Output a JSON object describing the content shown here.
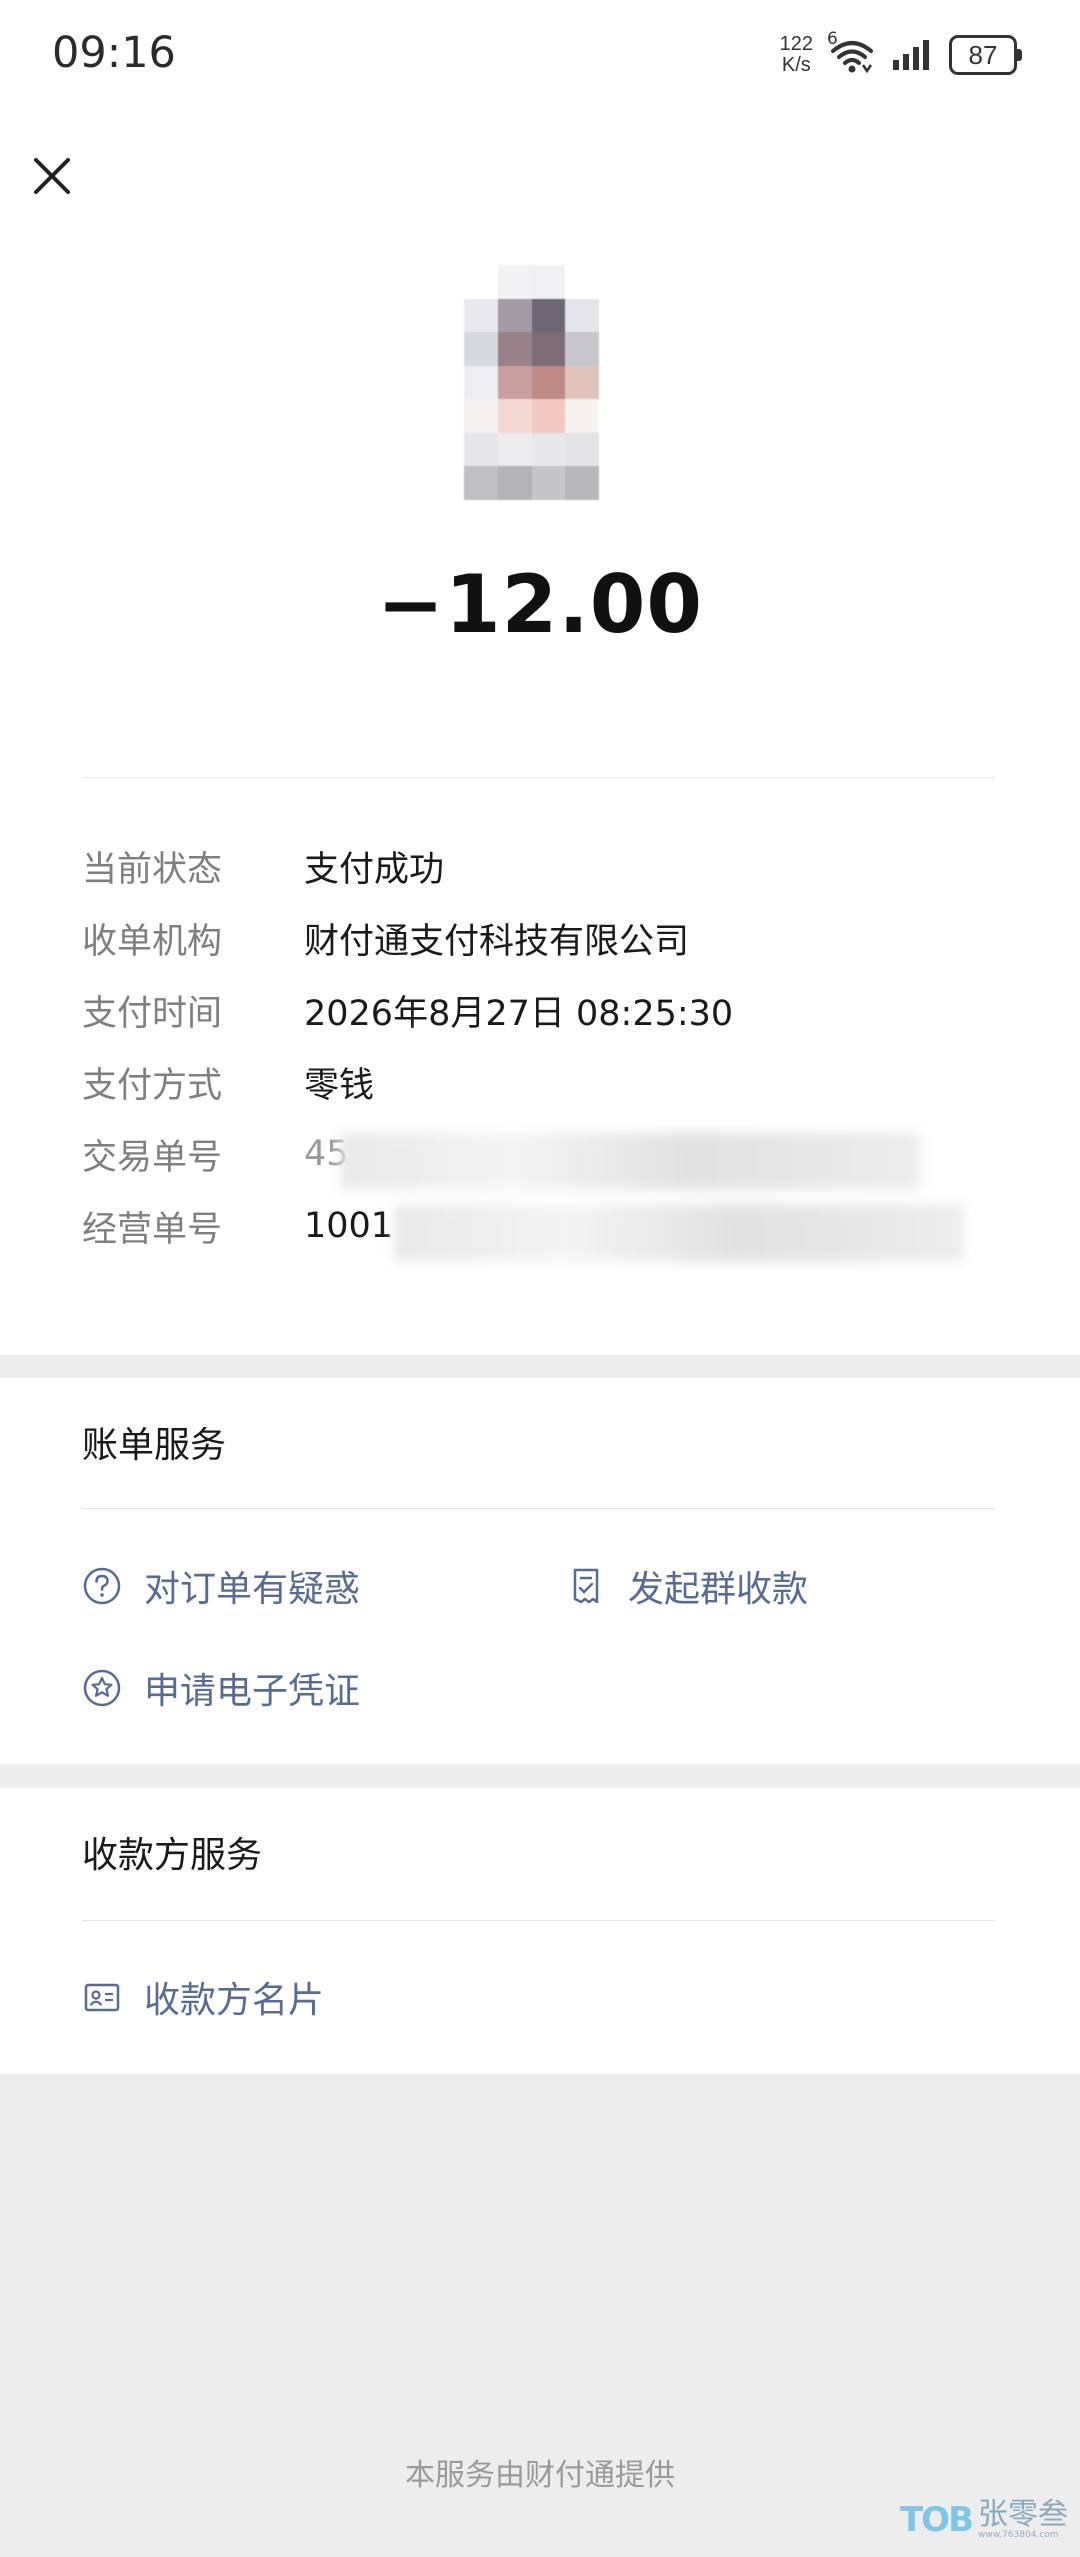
{
  "status_bar": {
    "time": "09:16",
    "net_speed_value": "122",
    "net_speed_unit": "K/s",
    "wifi_badge": "6",
    "battery": "87",
    "icons": [
      "wifi-icon",
      "signal-icon",
      "battery-icon"
    ]
  },
  "header": {
    "close_icon": "close-icon"
  },
  "payment": {
    "amount": "−12.00",
    "details": [
      {
        "label": "当前状态",
        "value": "支付成功"
      },
      {
        "label": "收单机构",
        "value": "财付通支付科技有限公司"
      },
      {
        "label": "支付时间",
        "value": "2026年8月27日 08:25:30"
      },
      {
        "label": "支付方式",
        "value": "零钱"
      },
      {
        "label": "交易单号",
        "value": "45"
      },
      {
        "label": "经营单号",
        "value": "1001"
      }
    ]
  },
  "bill_service": {
    "title": "账单服务",
    "actions": [
      {
        "label": "对订单有疑惑",
        "icon": "question-circle-icon"
      },
      {
        "label": "发起群收款",
        "icon": "receipt-check-icon"
      },
      {
        "label": "申请电子凭证",
        "icon": "star-badge-icon"
      }
    ]
  },
  "payee_service": {
    "title": "收款方服务",
    "actions": [
      {
        "label": "收款方名片",
        "icon": "contact-card-icon"
      }
    ]
  },
  "footer": {
    "text": "本服务由财付通提供"
  },
  "watermark": {
    "logo": "TOB",
    "text": "张零叁",
    "sub": "www.763804.com"
  },
  "colors": {
    "link": "#576b95",
    "label": "#7f7f7f",
    "background": "#ededed"
  }
}
